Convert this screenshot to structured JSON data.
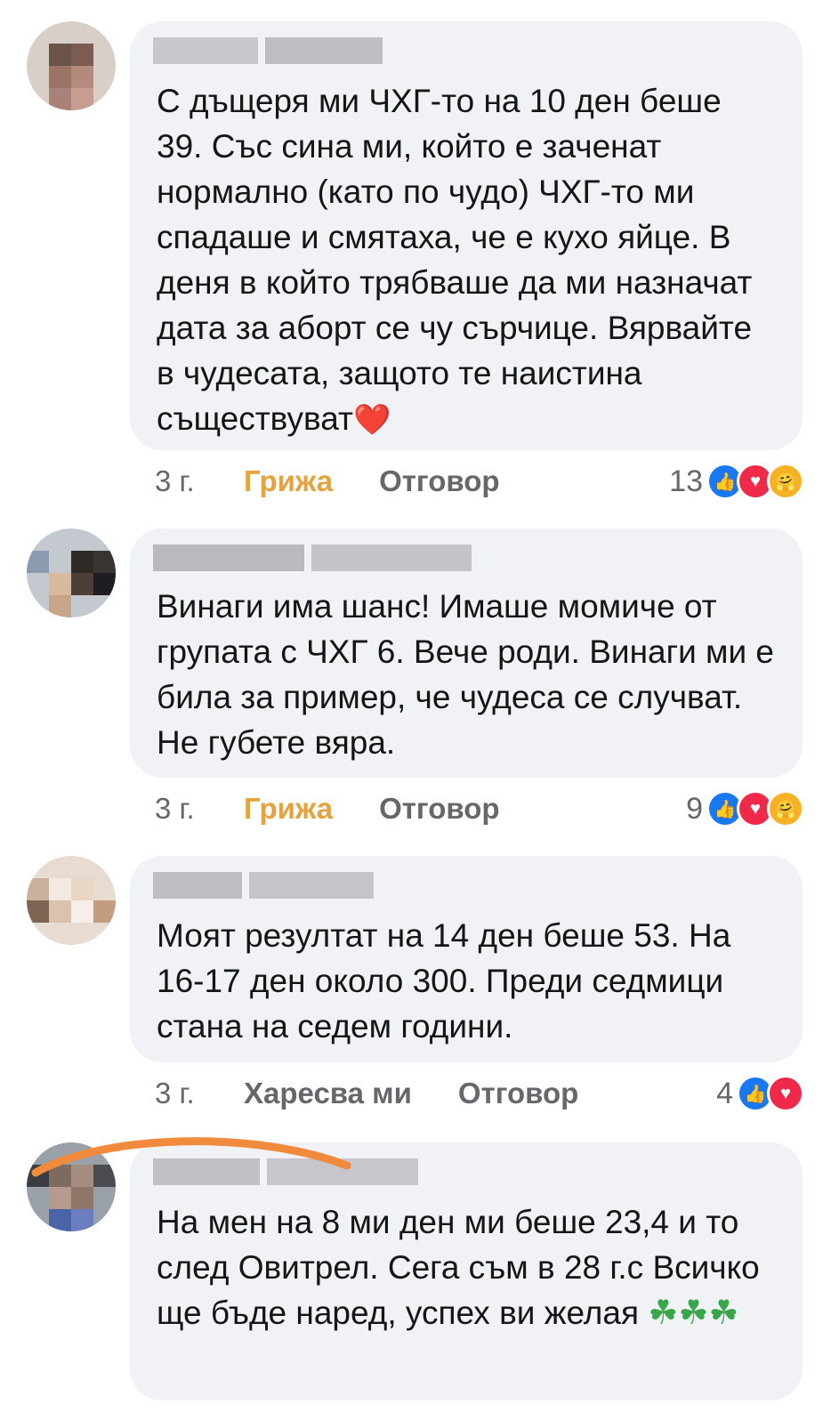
{
  "comments": [
    {
      "text": "С дъщеря ми ЧХГ-то на 10 ден беше 39. Със сина ми, който е заченат нормално (като по чудо) ЧХГ-то ми спадаше и смятаха, че е кухо яйце. В деня в който трябваше да ми назначат дата за аборт се чу сърчице. Вярвайте в чудесата, защото те наистина съществуват",
      "emoji": "❤️",
      "age": "3 г.",
      "reaction_label": "Грижа",
      "reply": "Отговор",
      "count": "13",
      "reactions": [
        "like-icon",
        "love-icon",
        "care-icon"
      ]
    },
    {
      "text": "Винаги има шанс! Имаше момиче от групата с ЧХГ 6. Вече роди. Винаги ми е била за пример, че чудеса се случват. Не губете вяра.",
      "age": "3 г.",
      "reaction_label": "Грижа",
      "reply": "Отговор",
      "count": "9",
      "reactions": [
        "like-icon",
        "love-icon",
        "care-icon"
      ]
    },
    {
      "text": "Моят резултат на 14 ден беше 53. На 16-17 ден около 300. Преди седмици стана на седем години.",
      "age": "3 г.",
      "reaction_label": "Харесва ми",
      "reply": "Отговор",
      "count": "4",
      "reactions": [
        "like-icon",
        "love-icon"
      ]
    },
    {
      "text": "На мен на 8 ми ден ми беше 23,4 и то след Овитрел. Сега съм в 28 г.с Всичко ще бъде наред, успех ви желая",
      "emoji": "☘☘☘"
    }
  ],
  "colors": {
    "care": "#e6a23c",
    "like": "#1877f2",
    "love": "#f0284a",
    "bubble": "#f0f2f5",
    "annotation_stroke": "#f08a3c"
  }
}
